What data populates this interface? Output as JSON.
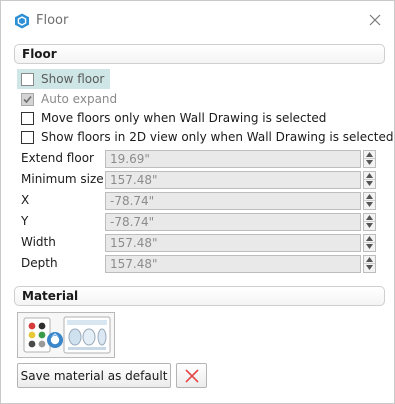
{
  "window": {
    "title": "Floor"
  },
  "floor_section": {
    "header": "Floor",
    "checkboxes": [
      {
        "label": "Show floor",
        "checked": false,
        "enabled": true,
        "highlighted": true
      },
      {
        "label": "Auto expand",
        "checked": true,
        "enabled": false
      },
      {
        "label": "Move floors only when Wall Drawing is selected",
        "checked": false,
        "enabled": true
      },
      {
        "label": "Show floors in 2D view only when Wall Drawing is selected",
        "checked": false,
        "enabled": true
      }
    ],
    "fields": [
      {
        "label": "Extend floor",
        "value": "19.69\""
      },
      {
        "label": "Minimum size",
        "value": "157.48\""
      },
      {
        "label": "X",
        "value": "-78.74\""
      },
      {
        "label": "Y",
        "value": "-78.74\""
      },
      {
        "label": "Width",
        "value": "157.48\""
      },
      {
        "label": "Depth",
        "value": "157.48\""
      }
    ]
  },
  "material_section": {
    "header": "Material",
    "save_button": "Save material as default",
    "delete_icon": "red-x-icon"
  },
  "colors": {
    "accent": "#2d8fd6",
    "highlight": "#cfe6e6",
    "delete": "#e34a4a"
  }
}
